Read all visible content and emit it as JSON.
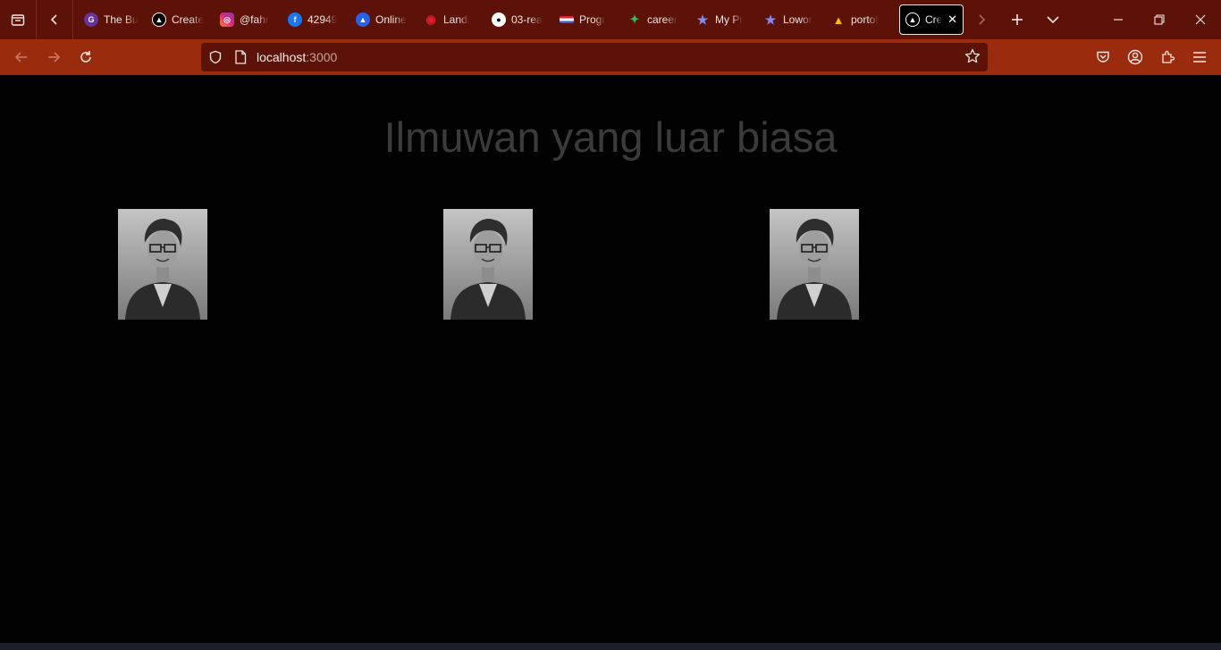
{
  "browser": {
    "tabs": [
      {
        "title": "The Bu",
        "icon": "gatsby-icon",
        "color": "#663399"
      },
      {
        "title": "Create",
        "icon": "nextjs-icon",
        "color": "#000000"
      },
      {
        "title": "@fahr",
        "icon": "instagram-icon",
        "color": "#e1306c"
      },
      {
        "title": "42949",
        "icon": "facebook-icon",
        "color": "#1877f2"
      },
      {
        "title": "Online",
        "icon": "online-icon",
        "color": "#2563eb"
      },
      {
        "title": "Landi",
        "icon": "wifi-icon",
        "color": "#e11d2e"
      },
      {
        "title": "03-rea",
        "icon": "github-icon",
        "color": "#ffffff"
      },
      {
        "title": "Progr",
        "icon": "flag-icon",
        "color": "#3b5bdb"
      },
      {
        "title": "career",
        "icon": "career-icon",
        "color": "#22c55e"
      },
      {
        "title": "My Pr",
        "icon": "star-icon",
        "color": "#6366f1"
      },
      {
        "title": "Lowor",
        "icon": "star-icon",
        "color": "#6366f1"
      },
      {
        "title": "portof",
        "icon": "google-drive-icon",
        "color": "#fbbc04"
      }
    ],
    "active_tab": {
      "title": "Cre",
      "icon": "nextjs-icon"
    },
    "url_host": "localhost",
    "url_port": ":3000"
  },
  "page": {
    "heading": "Ilmuwan yang luar biasa",
    "photos": [
      {
        "alt": "scientist-photo"
      },
      {
        "alt": "scientist-photo"
      },
      {
        "alt": "scientist-photo"
      }
    ]
  },
  "colors": {
    "tab_strip": "#5c1206",
    "toolbar": "#9a2b0d",
    "page_bg": "#020202",
    "heading_text": "#3b3b3b"
  }
}
